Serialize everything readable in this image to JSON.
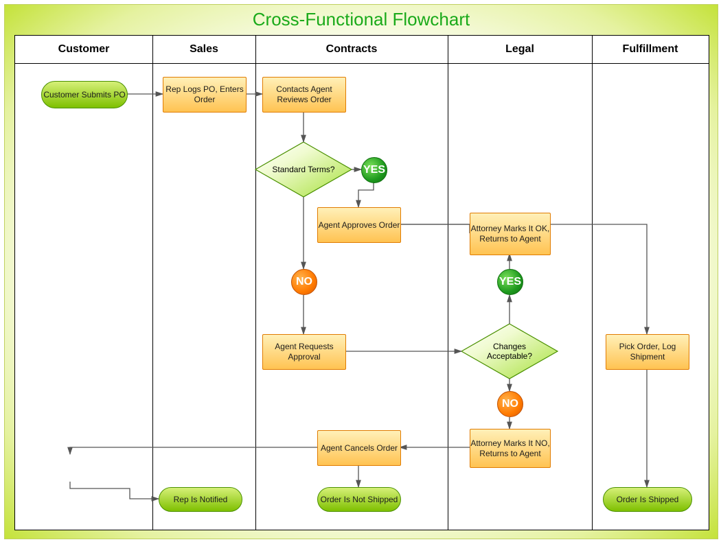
{
  "title": "Cross-Functional Flowchart",
  "lanes": {
    "customer": "Customer",
    "sales": "Sales",
    "contracts": "Contracts",
    "legal": "Legal",
    "fulfillment": "Fulfillment"
  },
  "nodes": {
    "start": "Customer Submits PO",
    "repLogs": "Rep Logs PO, Enters Order",
    "agentReview": "Contacts Agent Reviews Order",
    "stdTerms": "Standard Terms?",
    "yes1": "YES",
    "no1": "NO",
    "agentApprove": "Agent Approves Order",
    "agentRequest": "Agent Requests Approval",
    "changes": "Changes Acceptable?",
    "yes2": "YES",
    "no2": "NO",
    "attyOK": "Attorney Marks It OK, Returns to Agent",
    "attyNO": "Attorney Marks It NO, Returns to Agent",
    "agentCancel": "Agent Cancels Order",
    "repNotified": "Rep Is Notified",
    "notShipped": "Order Is Not Shipped",
    "pick": "Pick Order, Log Shipment",
    "shipped": "Order Is Shipped"
  }
}
